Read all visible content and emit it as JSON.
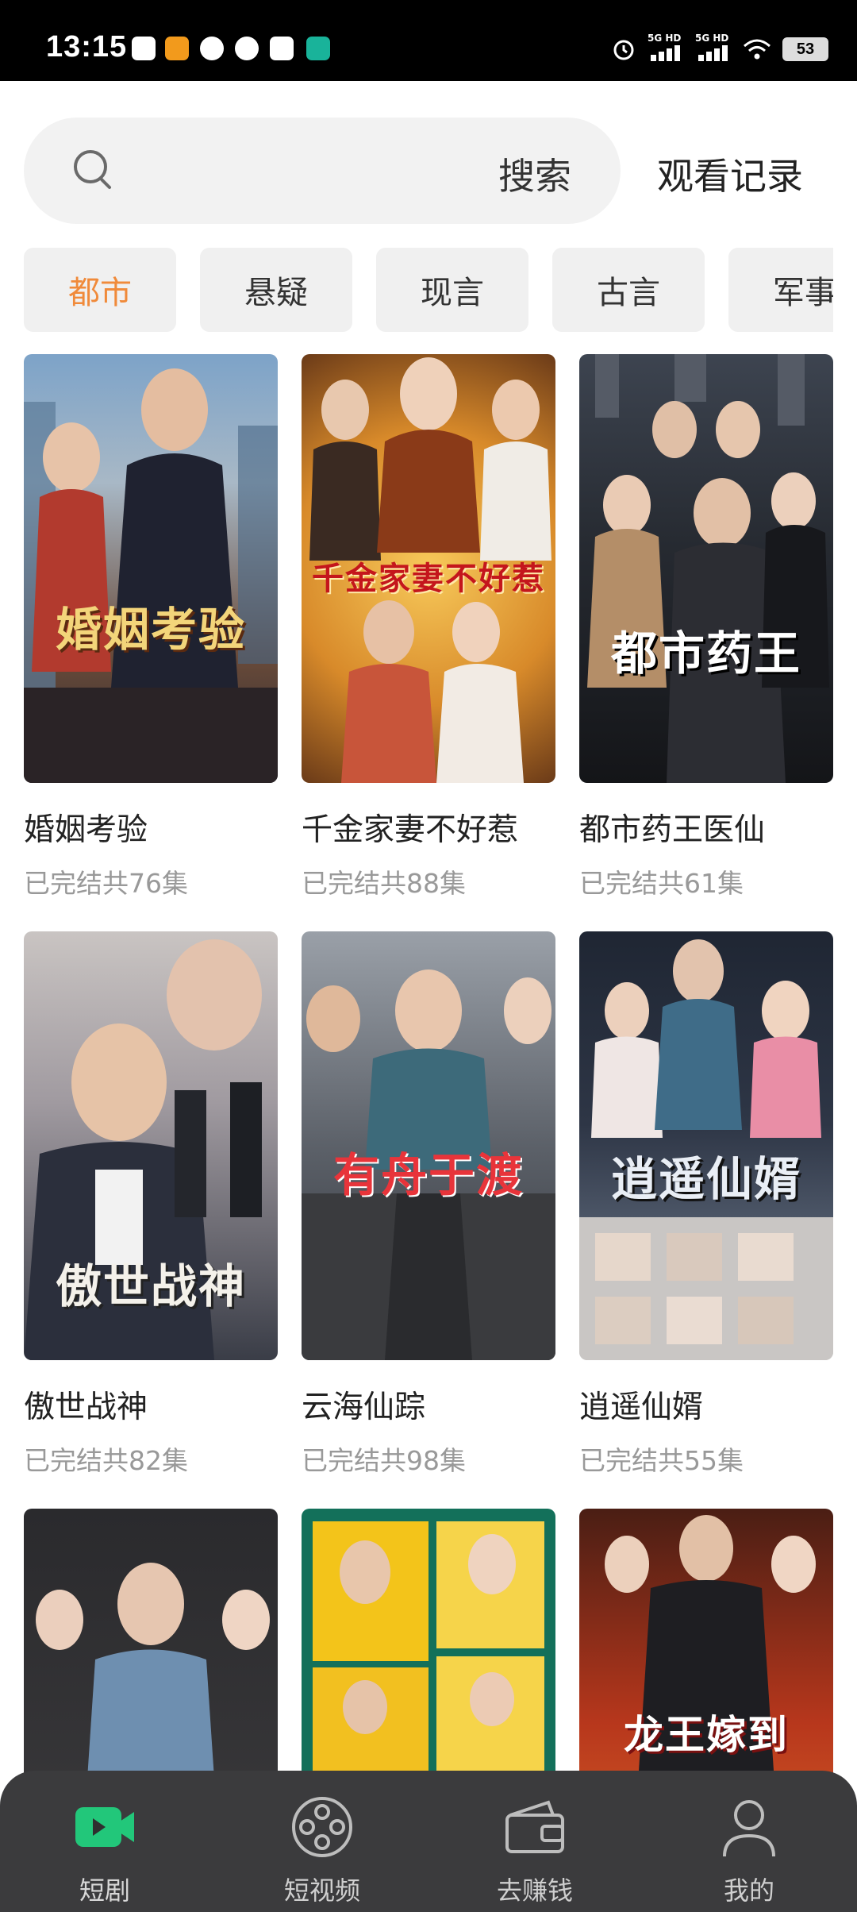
{
  "status_bar": {
    "time": "13:15",
    "network_1": "5G HD",
    "network_2": "5G HD",
    "battery": "53"
  },
  "search": {
    "button_label": "搜索",
    "history_label": "观看记录"
  },
  "categories": [
    {
      "label": "都市",
      "active": true
    },
    {
      "label": "悬疑",
      "active": false
    },
    {
      "label": "现言",
      "active": false
    },
    {
      "label": "古言",
      "active": false
    },
    {
      "label": "军事",
      "active": false
    }
  ],
  "dramas": [
    {
      "name": "婚姻考验",
      "status": "已完结共76集",
      "poster_title": "婚姻考验"
    },
    {
      "name": "千金家妻不好惹",
      "status": "已完结共88集",
      "poster_title": "千金家妻不好惹"
    },
    {
      "name": "都市药王医仙",
      "status": "已完结共61集",
      "poster_title": "都市药王"
    },
    {
      "name": "傲世战神",
      "status": "已完结共82集",
      "poster_title": "傲世战神"
    },
    {
      "name": "云海仙踪",
      "status": "已完结共98集",
      "poster_title": "有舟于渡"
    },
    {
      "name": "逍遥仙婿",
      "status": "已完结共55集",
      "poster_title": "逍遥仙婿"
    },
    {
      "name": "",
      "status": "",
      "poster_title": ""
    },
    {
      "name": "",
      "status": "",
      "poster_title": ""
    },
    {
      "name": "",
      "status": "",
      "poster_title": "龙王嫁到"
    }
  ],
  "bottom_nav": [
    {
      "label": "短剧",
      "icon": "video-icon",
      "active": true
    },
    {
      "label": "短视频",
      "icon": "film-reel-icon",
      "active": false
    },
    {
      "label": "去赚钱",
      "icon": "wallet-icon",
      "active": false
    },
    {
      "label": "我的",
      "icon": "profile-icon",
      "active": false
    }
  ],
  "colors": {
    "accent": "#f08a3a",
    "nav_active": "#22c77a",
    "nav_bg": "#3b3b3d"
  }
}
